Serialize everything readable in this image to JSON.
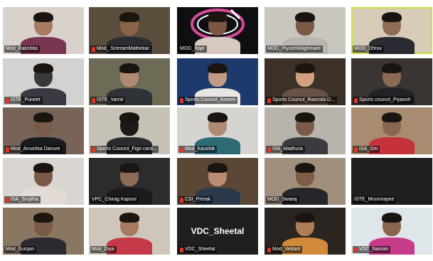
{
  "colors": {
    "active_border": "#c6e23a",
    "mic_muted": "#e0352b",
    "label_bg": "rgba(0,0,0,0.55)"
  },
  "tiles": [
    {
      "name": "Mod_Rakshita",
      "muted": false,
      "bg": "#d9d2cc",
      "skin": "#a97a62",
      "shirt": "#7a3550"
    },
    {
      "name": "Mod_ SrreramMathekar",
      "muted": true,
      "bg": "#5b4d3c",
      "skin": "#8a6446",
      "shirt": "#2c2d33"
    },
    {
      "name": "MOD_Raje",
      "muted": false,
      "bg": "#0f0f12",
      "skin": "#7b5643",
      "shirt": "#d7c8c0",
      "logo": "logo-emblem"
    },
    {
      "name": "MOD_PiyushWaghmare",
      "muted": false,
      "bg": "#c9c6bf",
      "skin": "#7a5946",
      "shirt": "#b9b6b0"
    },
    {
      "name": "MOD_Dhruv",
      "muted": false,
      "bg": "#d8cbb8",
      "skin": "#8f6c55",
      "shirt": "#2a2b32",
      "active": true
    },
    {
      "name": "ISTE_Puneet",
      "muted": true,
      "bg": "#d3d2d0",
      "skin": "#3a3737",
      "shirt": "#3a3a42"
    },
    {
      "name": "ISTE_Varnit",
      "muted": true,
      "bg": "#6d6a55",
      "skin": "#b08a70",
      "shirt": "#2f3236"
    },
    {
      "name": "Sports Council_Aseem",
      "muted": true,
      "bg": "#1e3a6c",
      "skin": "#c09a82",
      "shirt": "#e8e6e3"
    },
    {
      "name": "Sports Council_Rasmita D...",
      "muted": true,
      "bg": "#3b3128",
      "skin": "#d0a080",
      "shirt": "#6a5146"
    },
    {
      "name": "Sports council_Piyansh",
      "muted": true,
      "bg": "#3a3532",
      "skin": "#8b6a55",
      "shirt": "#202226"
    },
    {
      "name": "Mod_Anushka Danure",
      "muted": true,
      "bg": "#786457",
      "skin": "#7a5b4a",
      "shirt": "#1a1b1f"
    },
    {
      "name": "Sports Council_Figo card...",
      "muted": true,
      "bg": "#c7c2b6",
      "skin": "#1c1a18",
      "shirt": "#2a2b30"
    },
    {
      "name": "Mod_Kaushik",
      "muted": true,
      "bg": "#d6d4d0",
      "skin": "#b08a72",
      "shirt": "#2d6b74"
    },
    {
      "name": "ISA_Madhura",
      "muted": true,
      "bg": "#b9b4ab",
      "skin": "#7b5a48",
      "shirt": "#3a3a40"
    },
    {
      "name": "ISA_Om",
      "muted": true,
      "bg": "#a88c72",
      "skin": "#8a6551",
      "shirt": "#c5323a"
    },
    {
      "name": "ISA_Srujitha",
      "muted": true,
      "bg": "#d9d6d2",
      "skin": "#7b5845",
      "shirt": "#e3dcd6"
    },
    {
      "name": "VPC_Chirag Kapoor",
      "muted": false,
      "bg": "#2c2c2c",
      "skin": "#8d6a55",
      "shirt": "#1b1b1d"
    },
    {
      "name": "CSI_Prerak",
      "muted": true,
      "bg": "#5a4736",
      "skin": "#b78c71",
      "shirt": "#2b3a4a"
    },
    {
      "name": "MOD_Swaraj",
      "muted": false,
      "bg": "#9f8f7c",
      "skin": "#7f5c47",
      "shirt": "#26272b"
    },
    {
      "name": "ISTE_Mrunmayee",
      "muted": false,
      "bg": "#1f1f1f",
      "blank": true
    },
    {
      "name": "Mod_Gunjan",
      "muted": false,
      "bg": "#8a7762",
      "skin": "#7a5a47",
      "shirt": "#2a2a30"
    },
    {
      "name": "Mod_Diya",
      "muted": false,
      "bg": "#cfc6bb",
      "skin": "#a67b62",
      "shirt": "#c53a48"
    },
    {
      "name": "VDC_Sheetal",
      "muted": true,
      "bg": "#1f1f1f",
      "blank": true,
      "center_text": "VDC_Sheetal"
    },
    {
      "name": "Mod_Vedant",
      "muted": true,
      "bg": "#2a2520",
      "skin": "#b07c56",
      "shirt": "#d08a3a"
    },
    {
      "name": "VDC_Naman",
      "muted": true,
      "bg": "#dfe6ea",
      "skin": "#8a654e",
      "shirt": "#c83a8a"
    }
  ]
}
